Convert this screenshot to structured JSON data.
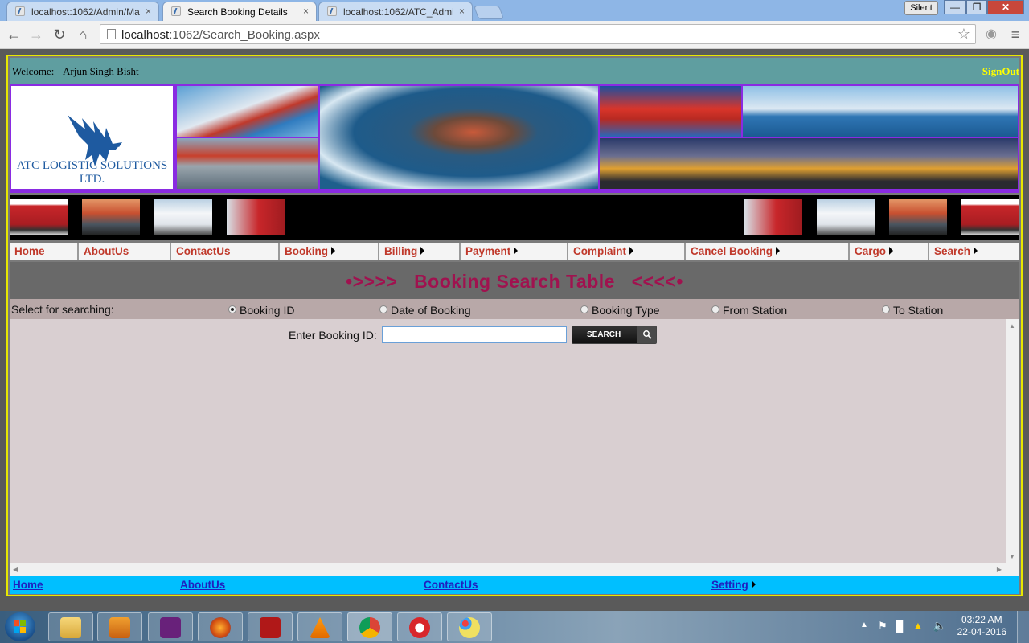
{
  "browser": {
    "tabs": [
      {
        "title": "localhost:1062/Admin/Ma",
        "active": false
      },
      {
        "title": "Search Booking Details",
        "active": true
      },
      {
        "title": "localhost:1062/ATC_Admi",
        "active": false
      }
    ],
    "tab_close_glyph": "×",
    "profile_label": "Silent",
    "url_host": "localhost",
    "url_path": ":1062/Search_Booking.aspx"
  },
  "header": {
    "welcome_label": "Welcome:",
    "user_name": "Arjun Singh Bisht",
    "signout_label": "SignOut"
  },
  "banner": {
    "company_name": "ATC LOGISTIC SOLUTIONS LTD."
  },
  "menu": [
    {
      "label": "Home",
      "has_submenu": false
    },
    {
      "label": "AboutUs",
      "has_submenu": false
    },
    {
      "label": "ContactUs",
      "has_submenu": false
    },
    {
      "label": "Booking",
      "has_submenu": true
    },
    {
      "label": "Billing",
      "has_submenu": true
    },
    {
      "label": "Payment",
      "has_submenu": true
    },
    {
      "label": "Complaint",
      "has_submenu": true
    },
    {
      "label": "Cancel Booking",
      "has_submenu": true
    },
    {
      "label": "Cargo",
      "has_submenu": true
    },
    {
      "label": "Search",
      "has_submenu": true
    }
  ],
  "page_title": "•>>>>   Booking Search Table   <<<<•",
  "search_options": {
    "label": "Select for searching:",
    "options": [
      {
        "label": "Booking ID",
        "selected": true
      },
      {
        "label": "Date of Booking",
        "selected": false
      },
      {
        "label": "Booking Type",
        "selected": false
      },
      {
        "label": "From Station",
        "selected": false
      },
      {
        "label": "To Station",
        "selected": false
      }
    ]
  },
  "search_form": {
    "field_label": "Enter Booking ID:",
    "field_value": "",
    "button_label": "SEARCH"
  },
  "footer": [
    {
      "label": "Home",
      "has_submenu": false
    },
    {
      "label": "AboutUs",
      "has_submenu": false
    },
    {
      "label": "ContactUs",
      "has_submenu": false
    },
    {
      "label": "Setting",
      "has_submenu": true
    }
  ],
  "taskbar": {
    "apps": [
      "file-explorer-icon",
      "media-player-icon",
      "visual-studio-icon",
      "firefox-icon",
      "adobe-reader-icon",
      "vlc-icon",
      "chrome-icon",
      "ccleaner-icon",
      "paint-icon"
    ],
    "time": "03:22 AM",
    "date": "22-04-2016"
  },
  "colors": {
    "welcome_bar": "#5f9ea0",
    "banner_border": "#8a2be2",
    "menu_text": "#c0392b",
    "title_text": "#a0124f",
    "footer_bar": "#00bfff",
    "page_border": "#e8e800"
  }
}
